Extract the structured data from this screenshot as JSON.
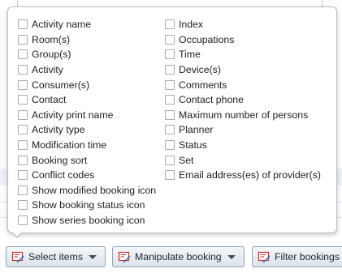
{
  "popup": {
    "left_column": [
      {
        "label": "Activity name",
        "checked": false
      },
      {
        "label": "Room(s)",
        "checked": false
      },
      {
        "label": "Group(s)",
        "checked": false
      },
      {
        "label": "Activity",
        "checked": false
      },
      {
        "label": "Consumer(s)",
        "checked": false
      },
      {
        "label": "Contact",
        "checked": false
      },
      {
        "label": "Activity print name",
        "checked": false
      },
      {
        "label": "Activity type",
        "checked": false
      },
      {
        "label": "Modification time",
        "checked": false
      },
      {
        "label": "Booking sort",
        "checked": false
      },
      {
        "label": "Conflict codes",
        "checked": false
      },
      {
        "label": "Show modified booking icon",
        "checked": false
      },
      {
        "label": "Show booking status icon",
        "checked": false
      },
      {
        "label": "Show series booking icon",
        "checked": false
      }
    ],
    "right_column": [
      {
        "label": "Index",
        "checked": false
      },
      {
        "label": "Occupations",
        "checked": false
      },
      {
        "label": "Time",
        "checked": false
      },
      {
        "label": "Device(s)",
        "checked": false
      },
      {
        "label": "Comments",
        "checked": false
      },
      {
        "label": "Contact phone",
        "checked": false
      },
      {
        "label": "Maximum number of persons",
        "checked": false
      },
      {
        "label": "Planner",
        "checked": false
      },
      {
        "label": "Status",
        "checked": false
      },
      {
        "label": "Set",
        "checked": false
      },
      {
        "label": "Email address(es) of provider(s)",
        "checked": false
      }
    ]
  },
  "toolbar": {
    "select_items_label": "Select items",
    "manipulate_booking_label": "Manipulate booking",
    "filter_bookings_label": "Filter bookings"
  },
  "colors": {
    "button_border": "#8fa3ba",
    "icon_red": "#c8312b",
    "icon_blue": "#2f6bd1"
  }
}
